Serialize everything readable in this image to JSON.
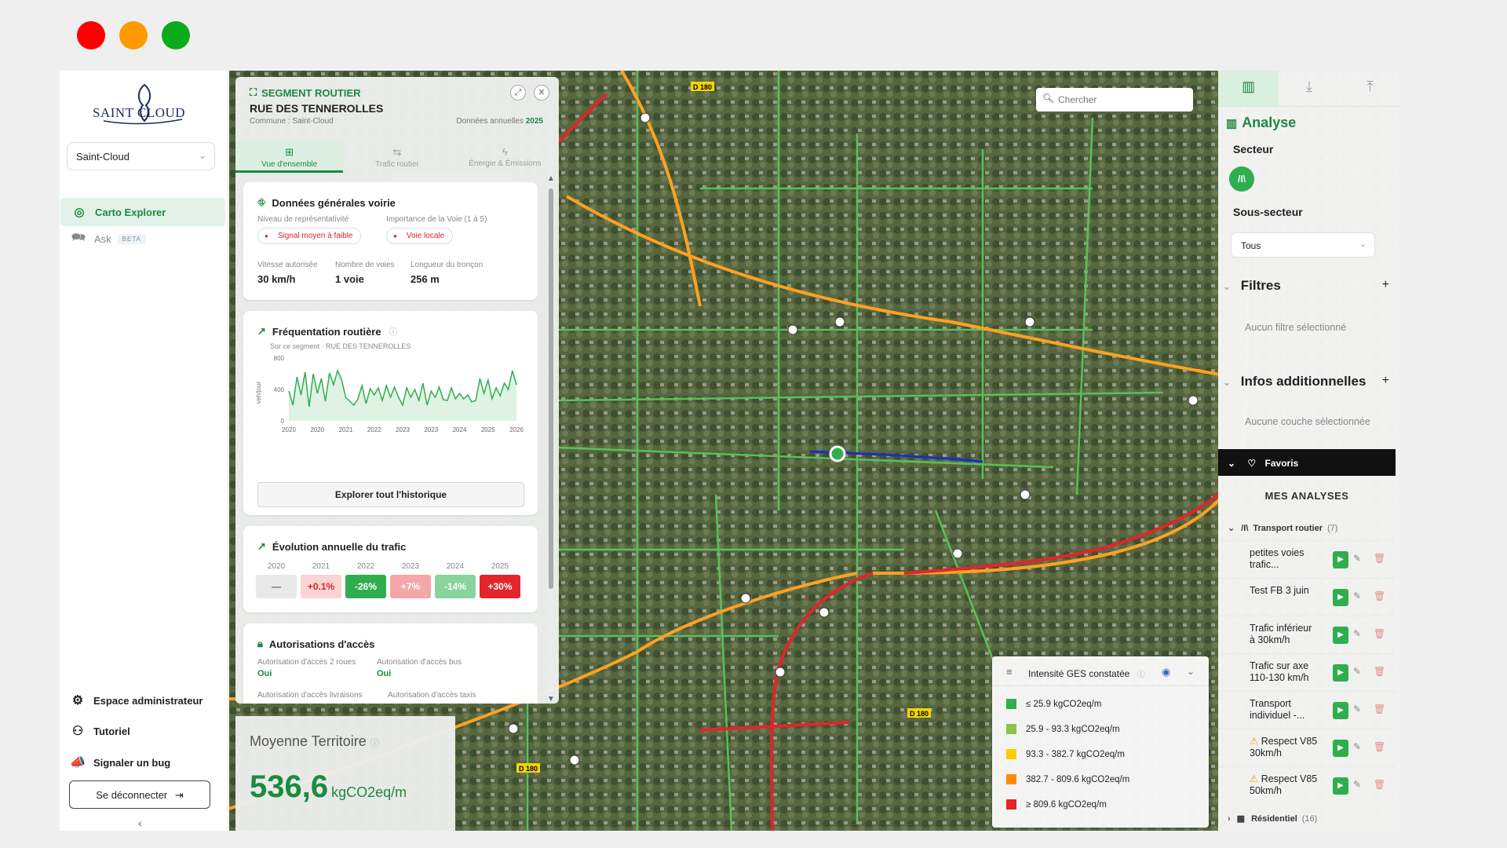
{
  "window": {
    "colors": {
      "close": "#ff0000",
      "minimize": "#ff9900",
      "maximize": "#0aaa18"
    }
  },
  "nav": {
    "logo_text": "SAINT CLOUD",
    "commune_select": "Saint-Cloud",
    "items": [
      {
        "label": "Carto Explorer",
        "icon": "target-icon",
        "active": true
      },
      {
        "label": "Ask",
        "badge": "BETA",
        "icon": "chat-icon",
        "active": false
      }
    ],
    "bottom": [
      {
        "label": "Espace administrateur",
        "icon": "gear-icon"
      },
      {
        "label": "Tutoriel",
        "icon": "flow-icon"
      },
      {
        "label": "Signaler un bug",
        "icon": "megaphone-icon"
      }
    ],
    "logout": "Se déconnecter",
    "collapse": "‹"
  },
  "segment": {
    "type": "SEGMENT ROUTIER",
    "name": "RUE DES TENNEROLLES",
    "commune": "Commune : Saint-Cloud",
    "annual_label": "Données annuelles",
    "annual_year": "2025",
    "tabs": [
      {
        "label": "Vue d'ensemble",
        "active": true
      },
      {
        "label": "Trafic routier",
        "active": false
      },
      {
        "label": "Énergie & Émissions",
        "active": false
      }
    ],
    "general": {
      "title": "Données générales voirie",
      "rep_label": "Niveau de représentativité",
      "rep_value": "Signal moyen à faible",
      "imp_label": "Importance de la Voie (1 à 5)",
      "imp_value": "Voie locale",
      "speed_label": "Vitesse autorisée",
      "speed_value": "30 km/h",
      "lanes_label": "Nombre de voies",
      "lanes_value": "1 voie",
      "length_label": "Longueur du tronçon",
      "length_value": "256 m"
    },
    "freq": {
      "title": "Fréquentation routière",
      "subtitle": "Sur ce segment · RUE DES TENNEROLLES",
      "button": "Explorer tout l'historique"
    },
    "evolution": {
      "title": "Évolution annuelle du trafic",
      "years": [
        "2020",
        "2021",
        "2022",
        "2023",
        "2024",
        "2025"
      ],
      "values": [
        "—",
        "+0.1%",
        "-26%",
        "+7%",
        "-14%",
        "+30%"
      ],
      "colors": [
        "#e9e9e9",
        "#f8d4d4",
        "#2fae4f",
        "#f5a6a6",
        "#88d49a",
        "#e3242b"
      ],
      "text_colors": [
        "#666",
        "#d8242b",
        "#ffffff",
        "#ffffff",
        "#ffffff",
        "#ffffff"
      ]
    },
    "access": {
      "title": "Autorisations d'accès",
      "a1_label": "Autorisation d'accès 2 roues",
      "a1_value": "Oui",
      "a2_label": "Autorisation d'accès bus",
      "a2_value": "Oui",
      "a3_label": "Autorisation d'accès livraisons",
      "a4_label": "Autorisation d'accès taxis"
    }
  },
  "chart_data": {
    "type": "line",
    "ylabel": "veh/jour",
    "ylim": [
      0,
      800
    ],
    "yticks": [
      "800",
      "400",
      "0"
    ],
    "xticks": [
      "2020",
      "2020",
      "2021",
      "2022",
      "2023",
      "2023",
      "2024",
      "2025",
      "2026"
    ],
    "series": [
      {
        "values": [
          380,
          200,
          560,
          330,
          620,
          180,
          600,
          350,
          540,
          250,
          610,
          460,
          640,
          520,
          300,
          250,
          200,
          280,
          450,
          220,
          410,
          330,
          420,
          260,
          450,
          300,
          430,
          300,
          200,
          420,
          300,
          400,
          260,
          480,
          200,
          380,
          300,
          430,
          270,
          260,
          420,
          280,
          350,
          280,
          330,
          240,
          260,
          540,
          350,
          520,
          280,
          420,
          320,
          480,
          400,
          640,
          460
        ]
      }
    ]
  },
  "moyenne": {
    "title": "Moyenne Territoire",
    "value": "536,6",
    "unit": "kgCO2eq/m"
  },
  "map": {
    "search_placeholder": "Chercher",
    "road_labels": [
      "D 180",
      "D 180",
      "D 180"
    ]
  },
  "legend": {
    "title": "Intensité GES constatée",
    "items": [
      {
        "label": "≤ 25.9 kgCO2eq/m",
        "color": "#2fae4f"
      },
      {
        "label": "25.9 - 93.3 kgCO2eq/m",
        "color": "#8bc34a"
      },
      {
        "label": "93.3 - 382.7 kgCO2eq/m",
        "color": "#ffcc00"
      },
      {
        "label": "382.7 - 809.6 kgCO2eq/m",
        "color": "#ff8c00"
      },
      {
        "label": "≥ 809.6 kgCO2eq/m",
        "color": "#e3242b"
      }
    ]
  },
  "right": {
    "tabs": [
      "chart-icon",
      "download-icon",
      "upload-icon"
    ],
    "title": "Analyse",
    "secteur": "Secteur",
    "secteur_icon": "/I\\",
    "sous_secteur": "Sous-secteur",
    "sous_select": "Tous",
    "filtres": "Filtres",
    "filtres_empty": "Aucun filtre sélectionné",
    "infos": "Infos additionnelles",
    "infos_empty": "Aucune couche sélectionnée",
    "favoris": "Favoris",
    "mes_analyses": "MES ANALYSES",
    "group1": "Transport routier",
    "group1_count": "(7)",
    "analyses": [
      {
        "name": "petites voies trafic...",
        "warn": false
      },
      {
        "name": "Test FB 3 juin",
        "warn": false
      },
      {
        "name": "Trafic inférieur à 30km/h",
        "warn": false
      },
      {
        "name": "Trafic sur axe 110-130 km/h",
        "warn": false
      },
      {
        "name": "Transport individuel -...",
        "warn": false
      },
      {
        "name": "Respect V85 30km/h",
        "warn": true
      },
      {
        "name": "Respect V85 50km/h",
        "warn": true
      }
    ],
    "group2": "Résidentiel",
    "group2_count": "(16)"
  }
}
